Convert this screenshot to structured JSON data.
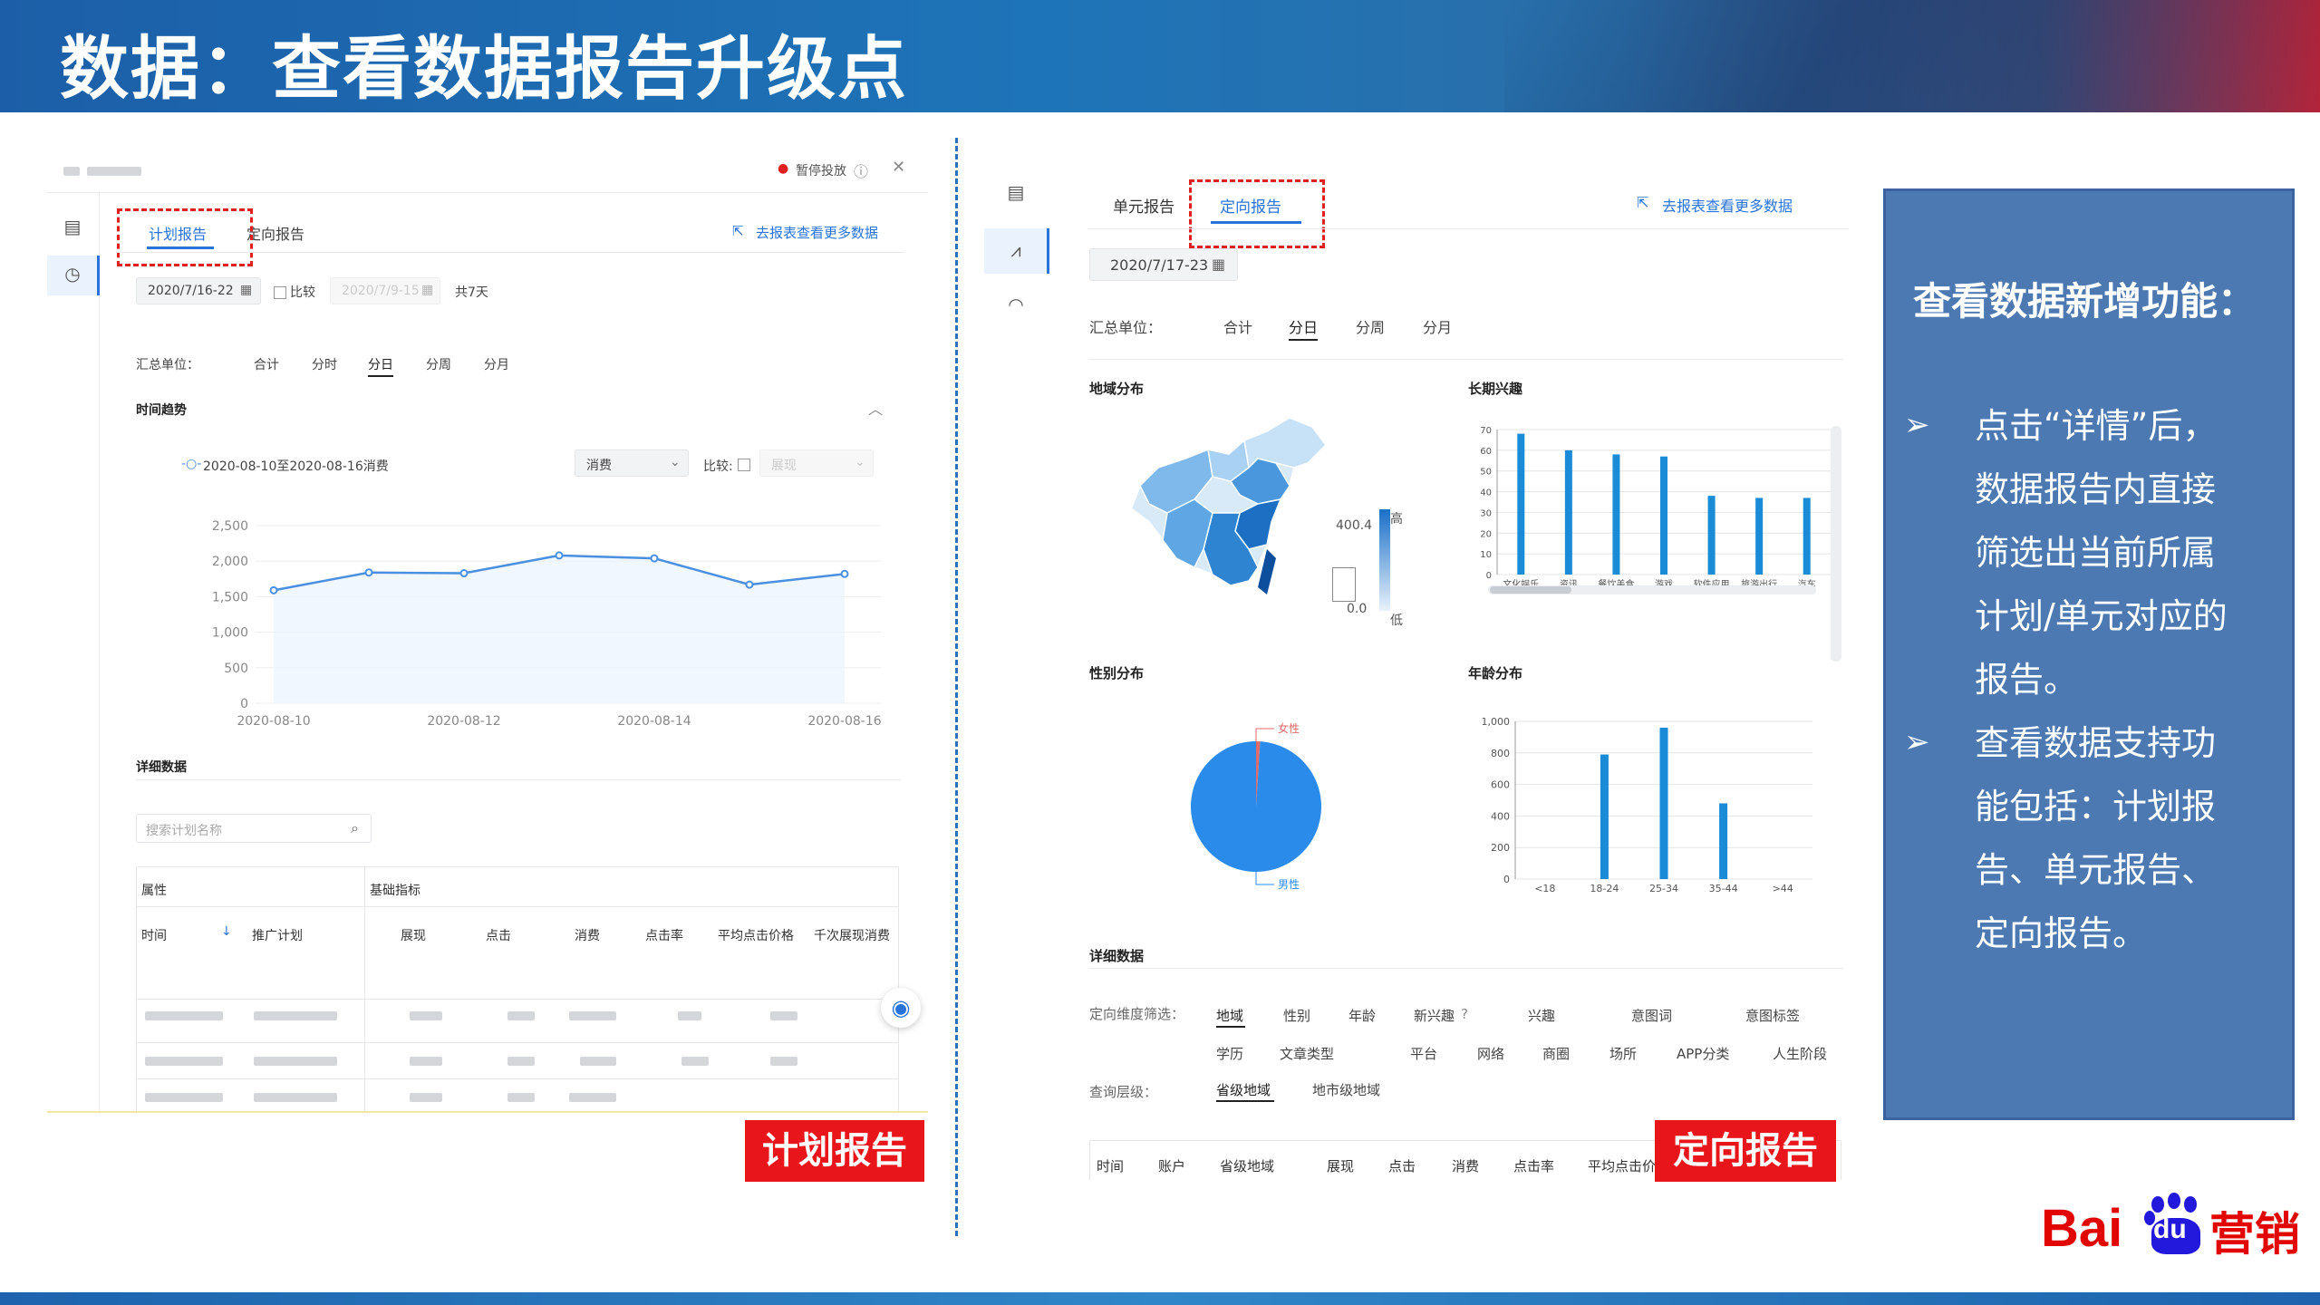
{
  "slide": {
    "title": "数据：查看数据报告升级点"
  },
  "left": {
    "header_status": "暂停投放",
    "tabs": [
      "计划报告",
      "定向报告"
    ],
    "link": "去报表查看更多数据",
    "date_range": "2020/7/16-22",
    "compare_label": "比较",
    "compare_date": "2020/7/9-15",
    "days": "共7天",
    "summary_label": "汇总单位：",
    "units": [
      "合计",
      "分时",
      "分日",
      "分周",
      "分月"
    ],
    "trend_title": "时间趋势",
    "legend": "2020-08-10至2020-08-16消费",
    "metric_select": "消费",
    "compare_select_label": "比较:",
    "compare_select": "展现",
    "chart_data": {
      "type": "line",
      "x": [
        "2020-08-10",
        "2020-08-11",
        "2020-08-12",
        "2020-08-13",
        "2020-08-14",
        "2020-08-15",
        "2020-08-16"
      ],
      "x_ticks": [
        "2020-08-10",
        "2020-08-12",
        "2020-08-14",
        "2020-08-16"
      ],
      "series": [
        {
          "name": "2020-08-10至2020-08-16消费",
          "values": [
            1590,
            1840,
            1830,
            2080,
            2040,
            1670,
            1820
          ]
        }
      ],
      "y_ticks": [
        "0",
        "500",
        "1,000",
        "1,500",
        "2,000",
        "2,500"
      ],
      "ylim": [
        0,
        2500
      ],
      "color": "#4a8fe0"
    },
    "detail_title": "详细数据",
    "search_placeholder": "搜索计划名称",
    "table_group_headers": [
      "属性",
      "基础指标"
    ],
    "table_headers": [
      "时间",
      "推广计划",
      "展现",
      "点击",
      "消费",
      "点击率",
      "平均点击价格",
      "千次展现消费"
    ]
  },
  "right": {
    "tabs": [
      "单元报告",
      "定向报告"
    ],
    "link": "去报表查看更多数据",
    "date_range": "2020/7/17-23",
    "summary_label": "汇总单位：",
    "units": [
      "合计",
      "分日",
      "分周",
      "分月"
    ],
    "map_title": "地域分布",
    "map_scale": {
      "max": "400.4",
      "min": "0.0",
      "high": "高",
      "low": "低"
    },
    "interest_title": "长期兴趣",
    "interest_chart": {
      "type": "bar",
      "categories": [
        "文化娱乐",
        "资讯",
        "餐饮美食",
        "游戏",
        "软件应用",
        "旅游出行",
        "汽车"
      ],
      "values": [
        68,
        60,
        58,
        57,
        38,
        37,
        37
      ],
      "y_ticks": [
        "0",
        "10",
        "20",
        "30",
        "40",
        "50",
        "60",
        "70"
      ],
      "ylim": [
        0,
        70
      ],
      "color": "#1a8bd6"
    },
    "gender_title": "性别分布",
    "gender_chart": {
      "type": "pie",
      "labels": [
        "女性",
        "男性"
      ],
      "values": [
        1,
        99
      ],
      "colors": [
        "#e36a6a",
        "#2b8bea"
      ]
    },
    "age_title": "年龄分布",
    "age_chart": {
      "type": "bar",
      "categories": [
        "<18",
        "18-24",
        "25-34",
        "35-44",
        ">44"
      ],
      "values": [
        0,
        790,
        960,
        480,
        0
      ],
      "y_ticks": [
        "0",
        "200",
        "400",
        "600",
        "800",
        "1,000"
      ],
      "ylim": [
        0,
        1000
      ],
      "color": "#1a8bd6"
    },
    "detail_title": "详细数据",
    "filter_label": "定向维度筛选：",
    "filters_row1": [
      "地域",
      "性别",
      "年龄",
      "新兴趣",
      "兴趣",
      "意图词",
      "意图标签"
    ],
    "filters_row2": [
      "学历",
      "文章类型",
      "平台",
      "网络",
      "商圈",
      "场所",
      "APP分类",
      "人生阶段"
    ],
    "level_label": "查询层级：",
    "levels": [
      "省级地域",
      "地市级地域"
    ],
    "table_headers": [
      "时间",
      "账户",
      "省级地域",
      "展现",
      "点击",
      "消费",
      "点击率",
      "平均点击价"
    ]
  },
  "tags": {
    "left": "计划报告",
    "right": "定向报告"
  },
  "info": {
    "title": "查看数据新增功能：",
    "bullet1": [
      "点击“详情”后，",
      "数据报告内直接",
      "筛选出当前所属",
      "计划/单元对应的",
      "报告。"
    ],
    "bullet2": [
      "查看数据支持功",
      "能包括：计划报",
      "告、单元报告、",
      "定向报告。"
    ]
  },
  "brand": {
    "logo_text": "Bai",
    "logo_du": "du",
    "logo_cn": "营销"
  }
}
